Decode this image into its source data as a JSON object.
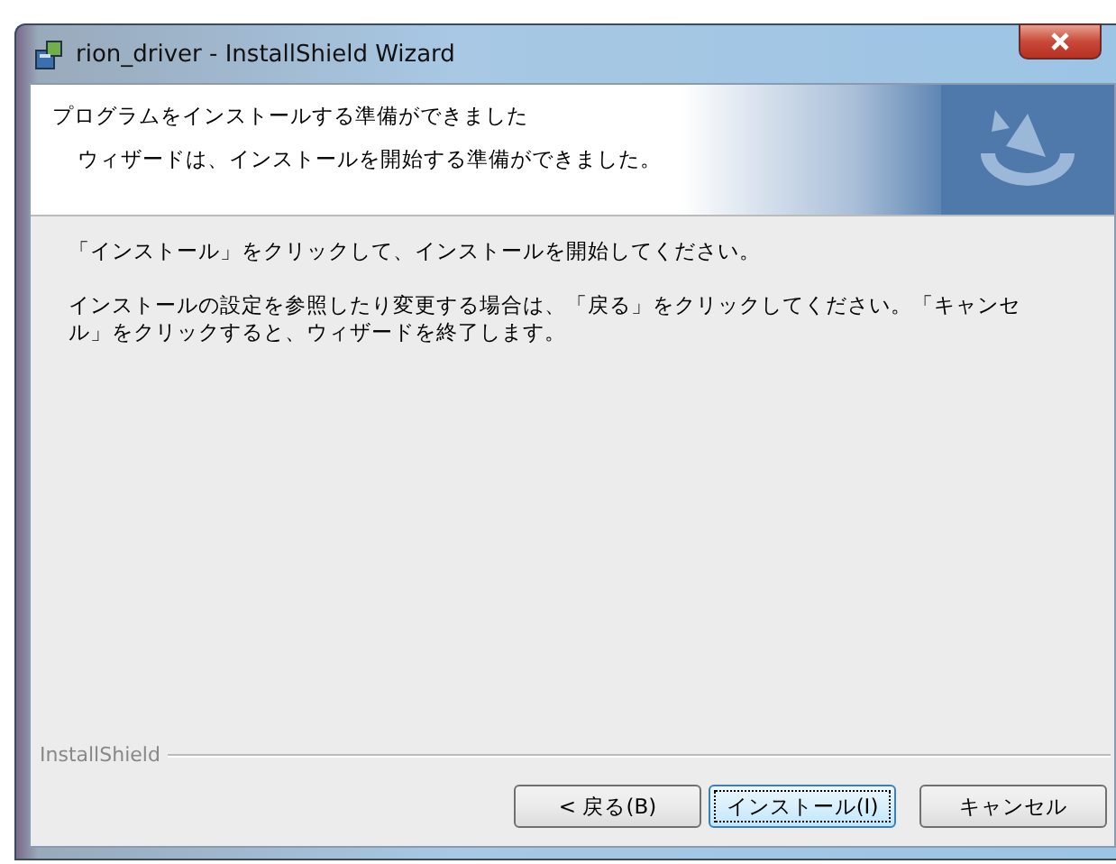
{
  "window": {
    "title": "rion_driver - InstallShield Wizard"
  },
  "header": {
    "title": "プログラムをインストールする準備ができました",
    "subtitle": "ウィザードは、インストールを開始する準備ができました。"
  },
  "body": [
    "「インストール」をクリックして、インストールを開始してください。",
    "インストールの設定を参照したり変更する場合は、「戻る」をクリックしてください。「キャンセル」をクリックすると、ウィザードを終了します。"
  ],
  "footer": {
    "brand": "InstallShield"
  },
  "buttons": [
    {
      "label": "< 戻る(B)",
      "default": false
    },
    {
      "label": "インストール(I)",
      "default": true
    },
    {
      "label": "キャンセル",
      "default": false
    }
  ]
}
